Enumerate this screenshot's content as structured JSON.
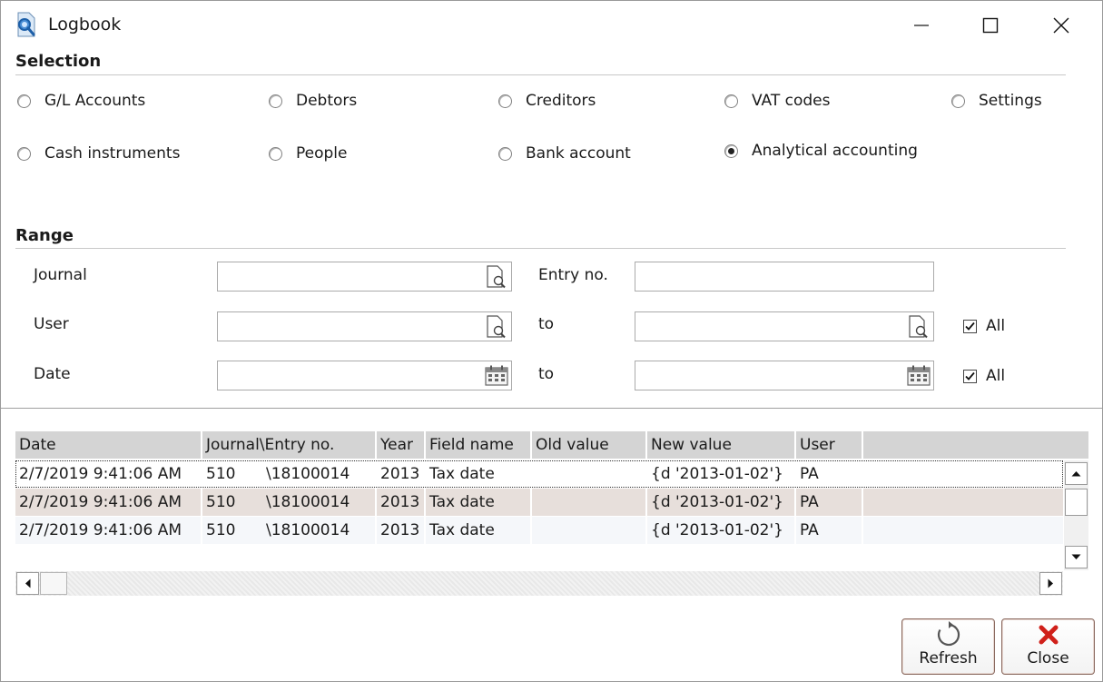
{
  "window": {
    "title": "Logbook"
  },
  "selection": {
    "title": "Selection",
    "options": [
      {
        "label": "G/L Accounts",
        "checked": false
      },
      {
        "label": "Debtors",
        "checked": false
      },
      {
        "label": "Creditors",
        "checked": false
      },
      {
        "label": "VAT codes",
        "checked": false
      },
      {
        "label": "Settings",
        "checked": false
      },
      {
        "label": "Cash instruments",
        "checked": false
      },
      {
        "label": "People",
        "checked": false
      },
      {
        "label": "Bank account",
        "checked": false
      },
      {
        "label": "Analytical accounting",
        "checked": true
      }
    ]
  },
  "range": {
    "title": "Range",
    "journal_label": "Journal",
    "journal_value": "",
    "entry_label": "Entry no.",
    "entry_value": "",
    "user_label": "User",
    "user_from": "",
    "user_to_label": "to",
    "user_to": "",
    "user_all_label": "All",
    "user_all_checked": true,
    "date_label": "Date",
    "date_from": "",
    "date_to_label": "to",
    "date_to": "",
    "date_all_label": "All",
    "date_all_checked": true
  },
  "grid": {
    "columns": [
      "Date",
      "Journal\\Entry no.",
      "Year",
      "Field name",
      "Old value",
      "New value",
      "User"
    ],
    "rows": [
      {
        "date": "2/7/2019 9:41:06 AM",
        "journal": "510",
        "entry": "\\18100014",
        "year": "2013",
        "field": "Tax date",
        "old": "",
        "new": "{d '2013-01-02'}",
        "user": "PA"
      },
      {
        "date": "2/7/2019 9:41:06 AM",
        "journal": "510",
        "entry": "\\18100014",
        "year": "2013",
        "field": "Tax date",
        "old": "",
        "new": "{d '2013-01-02'}",
        "user": "PA"
      },
      {
        "date": "2/7/2019 9:41:06 AM",
        "journal": "510",
        "entry": "\\18100014",
        "year": "2013",
        "field": "Tax date",
        "old": "",
        "new": "{d '2013-01-02'}",
        "user": "PA"
      }
    ]
  },
  "buttons": {
    "refresh": "Refresh",
    "close": "Close"
  },
  "colors": {
    "accent_red": "#d0201a",
    "refresh_icon": "#555555",
    "selected_row": "#e7dfdb"
  }
}
